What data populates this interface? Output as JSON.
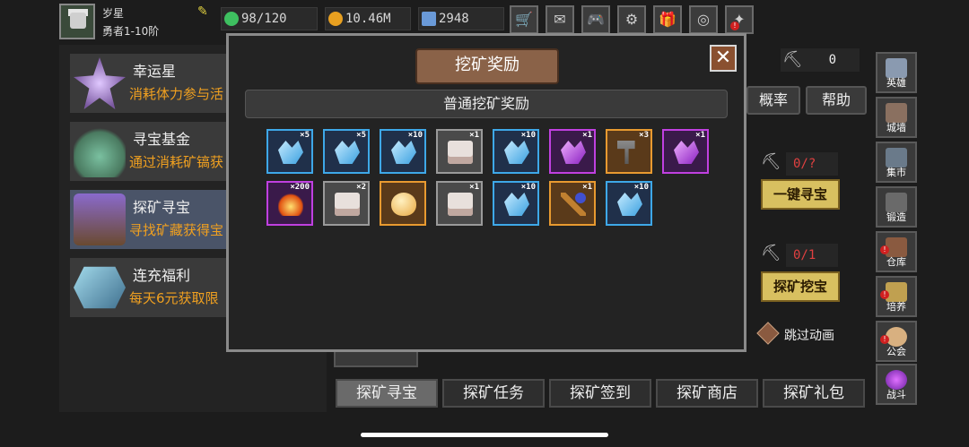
{
  "player": {
    "name": "岁星",
    "rank": "勇者1-10阶"
  },
  "resources": [
    {
      "value": "98/120",
      "icon": "energy-icon",
      "color": "#3ec060"
    },
    {
      "value": "10.46M",
      "icon": "gold-coin-icon",
      "color": "#e8a020"
    },
    {
      "value": "2948",
      "icon": "gem-icon",
      "color": "#6a9ad8"
    }
  ],
  "top_icons": [
    "shop-cart-icon",
    "mail-icon",
    "gamepad-icon",
    "settings-gear-icon",
    "gift-icon",
    "prize-wheel-icon",
    "fireworks-icon"
  ],
  "left_list": [
    {
      "title": "幸运星",
      "desc": "消耗体力参与活",
      "icon": "lucky-star-icon"
    },
    {
      "title": "寻宝基金",
      "desc": "通过消耗矿镐获",
      "icon": "treasure-bag-icon"
    },
    {
      "title": "探矿寻宝",
      "desc": "寻找矿藏获得宝",
      "icon": "treasure-chest-icon"
    },
    {
      "title": "连充福利",
      "desc": "每天6元获取限",
      "icon": "crystal-box-icon"
    }
  ],
  "right_area": {
    "pick_count": "0",
    "rate_button": "概率",
    "help_button": "帮助",
    "search_pick": "0/?",
    "search_button": "一键寻宝",
    "dig_pick": "0/1",
    "dig_button": "探矿挖宝",
    "skip_label": "跳过动画"
  },
  "side_menu": [
    {
      "label": "英雄",
      "icon": "hero-helmet-icon",
      "alert": false
    },
    {
      "label": "城墙",
      "icon": "castle-wall-icon",
      "alert": false
    },
    {
      "label": "集市",
      "icon": "market-stall-icon",
      "alert": false
    },
    {
      "label": "锻造",
      "icon": "anvil-icon",
      "alert": false
    },
    {
      "label": "仓库",
      "icon": "warehouse-icon",
      "alert": true
    },
    {
      "label": "培养",
      "icon": "training-icon",
      "alert": true
    },
    {
      "label": "公会",
      "icon": "guild-icon",
      "alert": true
    },
    {
      "label": "战斗",
      "icon": "battle-portal-icon",
      "alert": false
    }
  ],
  "bottom_tabs": [
    "探矿寻宝",
    "探矿任务",
    "探矿签到",
    "探矿商店",
    "探矿礼包"
  ],
  "active_tab": 0,
  "modal": {
    "title": "挖矿奖励",
    "subtitle": "普通挖矿奖励",
    "items": [
      {
        "qty": "×5",
        "kind": "crystal-blue",
        "frame": "b-blue"
      },
      {
        "qty": "×5",
        "kind": "crystal-blue",
        "frame": "b-blue"
      },
      {
        "qty": "×10",
        "kind": "crystal-blue",
        "frame": "b-blue"
      },
      {
        "qty": "×1",
        "kind": "chest",
        "frame": "b-gray"
      },
      {
        "qty": "×10",
        "kind": "crystal-blue",
        "frame": "b-blue"
      },
      {
        "qty": "×1",
        "kind": "crystal-purple",
        "frame": "b-purple"
      },
      {
        "qty": "×3",
        "kind": "hammer",
        "frame": "b-orange"
      },
      {
        "qty": "×1",
        "kind": "crystal-purple",
        "frame": "b-purple"
      },
      {
        "qty": "×200",
        "kind": "fire",
        "frame": "b-purple"
      },
      {
        "qty": "×2",
        "kind": "chest",
        "frame": "b-gray"
      },
      {
        "qty": "",
        "kind": "egg",
        "frame": "b-orange"
      },
      {
        "qty": "×1",
        "kind": "chest",
        "frame": "b-gray"
      },
      {
        "qty": "×10",
        "kind": "crystal-blue",
        "frame": "b-blue"
      },
      {
        "qty": "×1",
        "kind": "staff",
        "frame": "b-orange"
      },
      {
        "qty": "×10",
        "kind": "crystal-blue",
        "frame": "b-blue"
      }
    ]
  }
}
